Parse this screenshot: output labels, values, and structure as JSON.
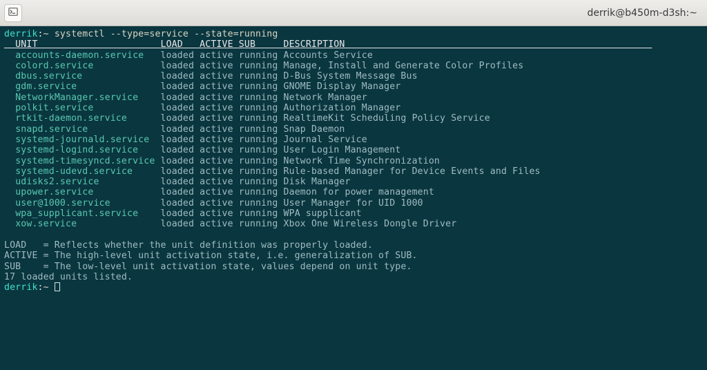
{
  "window": {
    "title": "derrik@b450m-d3sh:~"
  },
  "prompt": {
    "user": "derrik",
    "sep": ":",
    "cwd": "~",
    "marker": " "
  },
  "command": "systemctl --type=service --state=running",
  "columns": {
    "unit": "UNIT",
    "load": "LOAD",
    "active": "ACTIVE",
    "sub": "SUB",
    "description": "DESCRIPTION"
  },
  "col_widths": {
    "lead": 2,
    "unit": 26,
    "load": 7,
    "active": 7,
    "sub": 8
  },
  "rows": [
    {
      "unit": "accounts-daemon.service",
      "load": "loaded",
      "active": "active",
      "sub": "running",
      "description": "Accounts Service"
    },
    {
      "unit": "colord.service",
      "load": "loaded",
      "active": "active",
      "sub": "running",
      "description": "Manage, Install and Generate Color Profiles"
    },
    {
      "unit": "dbus.service",
      "load": "loaded",
      "active": "active",
      "sub": "running",
      "description": "D-Bus System Message Bus"
    },
    {
      "unit": "gdm.service",
      "load": "loaded",
      "active": "active",
      "sub": "running",
      "description": "GNOME Display Manager"
    },
    {
      "unit": "NetworkManager.service",
      "load": "loaded",
      "active": "active",
      "sub": "running",
      "description": "Network Manager"
    },
    {
      "unit": "polkit.service",
      "load": "loaded",
      "active": "active",
      "sub": "running",
      "description": "Authorization Manager"
    },
    {
      "unit": "rtkit-daemon.service",
      "load": "loaded",
      "active": "active",
      "sub": "running",
      "description": "RealtimeKit Scheduling Policy Service"
    },
    {
      "unit": "snapd.service",
      "load": "loaded",
      "active": "active",
      "sub": "running",
      "description": "Snap Daemon"
    },
    {
      "unit": "systemd-journald.service",
      "load": "loaded",
      "active": "active",
      "sub": "running",
      "description": "Journal Service"
    },
    {
      "unit": "systemd-logind.service",
      "load": "loaded",
      "active": "active",
      "sub": "running",
      "description": "User Login Management"
    },
    {
      "unit": "systemd-timesyncd.service",
      "load": "loaded",
      "active": "active",
      "sub": "running",
      "description": "Network Time Synchronization"
    },
    {
      "unit": "systemd-udevd.service",
      "load": "loaded",
      "active": "active",
      "sub": "running",
      "description": "Rule-based Manager for Device Events and Files"
    },
    {
      "unit": "udisks2.service",
      "load": "loaded",
      "active": "active",
      "sub": "running",
      "description": "Disk Manager"
    },
    {
      "unit": "upower.service",
      "load": "loaded",
      "active": "active",
      "sub": "running",
      "description": "Daemon for power management"
    },
    {
      "unit": "user@1000.service",
      "load": "loaded",
      "active": "active",
      "sub": "running",
      "description": "User Manager for UID 1000"
    },
    {
      "unit": "wpa_supplicant.service",
      "load": "loaded",
      "active": "active",
      "sub": "running",
      "description": "WPA supplicant"
    },
    {
      "unit": "xow.service",
      "load": "loaded",
      "active": "active",
      "sub": "running",
      "description": "Xbox One Wireless Dongle Driver"
    }
  ],
  "footer": {
    "lines": [
      "LOAD   = Reflects whether the unit definition was properly loaded.",
      "ACTIVE = The high-level unit activation state, i.e. generalization of SUB.",
      "SUB    = The low-level unit activation state, values depend on unit type.",
      "17 loaded units listed."
    ]
  }
}
